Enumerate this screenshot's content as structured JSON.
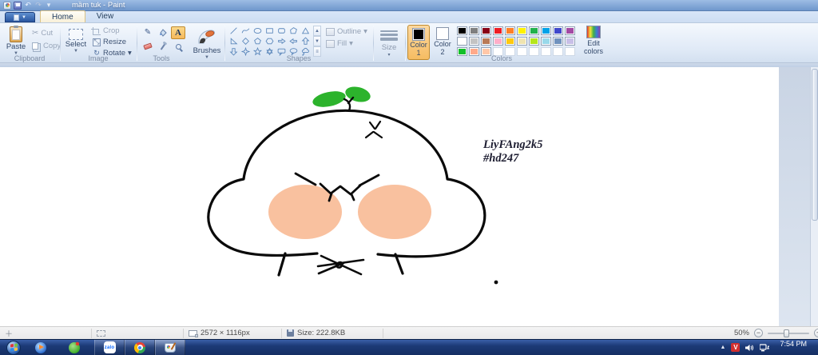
{
  "window": {
    "title": "mầm tuk - Paint"
  },
  "tabs": {
    "home": "Home",
    "view": "View"
  },
  "ribbon": {
    "clipboard": {
      "label": "Clipboard",
      "paste": "Paste",
      "cut": "Cut",
      "copy": "Copy"
    },
    "image": {
      "label": "Image",
      "select": "Select",
      "crop": "Crop",
      "resize": "Resize",
      "rotate": "Rotate"
    },
    "tools": {
      "label": "Tools",
      "brushes": "Brushes"
    },
    "shapes": {
      "label": "Shapes",
      "outline": "Outline",
      "fill": "Fill",
      "items": [
        "line",
        "curve",
        "oval",
        "rectangle",
        "rounded-rectangle",
        "polygon",
        "triangle",
        "right-triangle",
        "diamond",
        "pentagon",
        "hexagon",
        "right-arrow",
        "left-arrow",
        "up-arrow",
        "down-arrow",
        "four-point-star",
        "five-point-star",
        "six-point-star",
        "rounded-callout",
        "oval-callout",
        "cloud-callout"
      ]
    },
    "size": {
      "label": "Size"
    },
    "colors": {
      "label": "Colors",
      "color1_label": "Color 1",
      "color2_label": "Color 2",
      "edit_label": "Edit colors",
      "color1_value": "#000000",
      "color2_value": "#ffffff",
      "palette_row1": [
        "#000000",
        "#7f7f7f",
        "#880015",
        "#ed1c24",
        "#ff7f27",
        "#fff200",
        "#22b14c",
        "#00a2e8",
        "#3f48cc",
        "#a349a4"
      ],
      "palette_row2": [
        "#ffffff",
        "#c3c3c3",
        "#b97a57",
        "#ffaec9",
        "#ffc90e",
        "#efe4b0",
        "#b5e61d",
        "#99d9ea",
        "#7092be",
        "#c8bfe7"
      ],
      "palette_row3": [
        "#12bf2a",
        "#ffa98a",
        "#ffc7a8",
        "",
        "",
        "",
        "",
        "",
        "",
        ""
      ]
    }
  },
  "canvas": {
    "signature_line1": "LiyFAng2k5",
    "signature_line2": "#hd247",
    "sprout_color": "#2cb32c",
    "cheek_color": "#f9c19f",
    "outline_color": "#0a0a0a"
  },
  "statusbar": {
    "dimensions": "2572 × 1116px",
    "file_size": "Size: 222.8KB",
    "zoom_level": "50%"
  },
  "taskbar": {
    "zalo_label": "zalo",
    "clock": "7:54 PM"
  }
}
